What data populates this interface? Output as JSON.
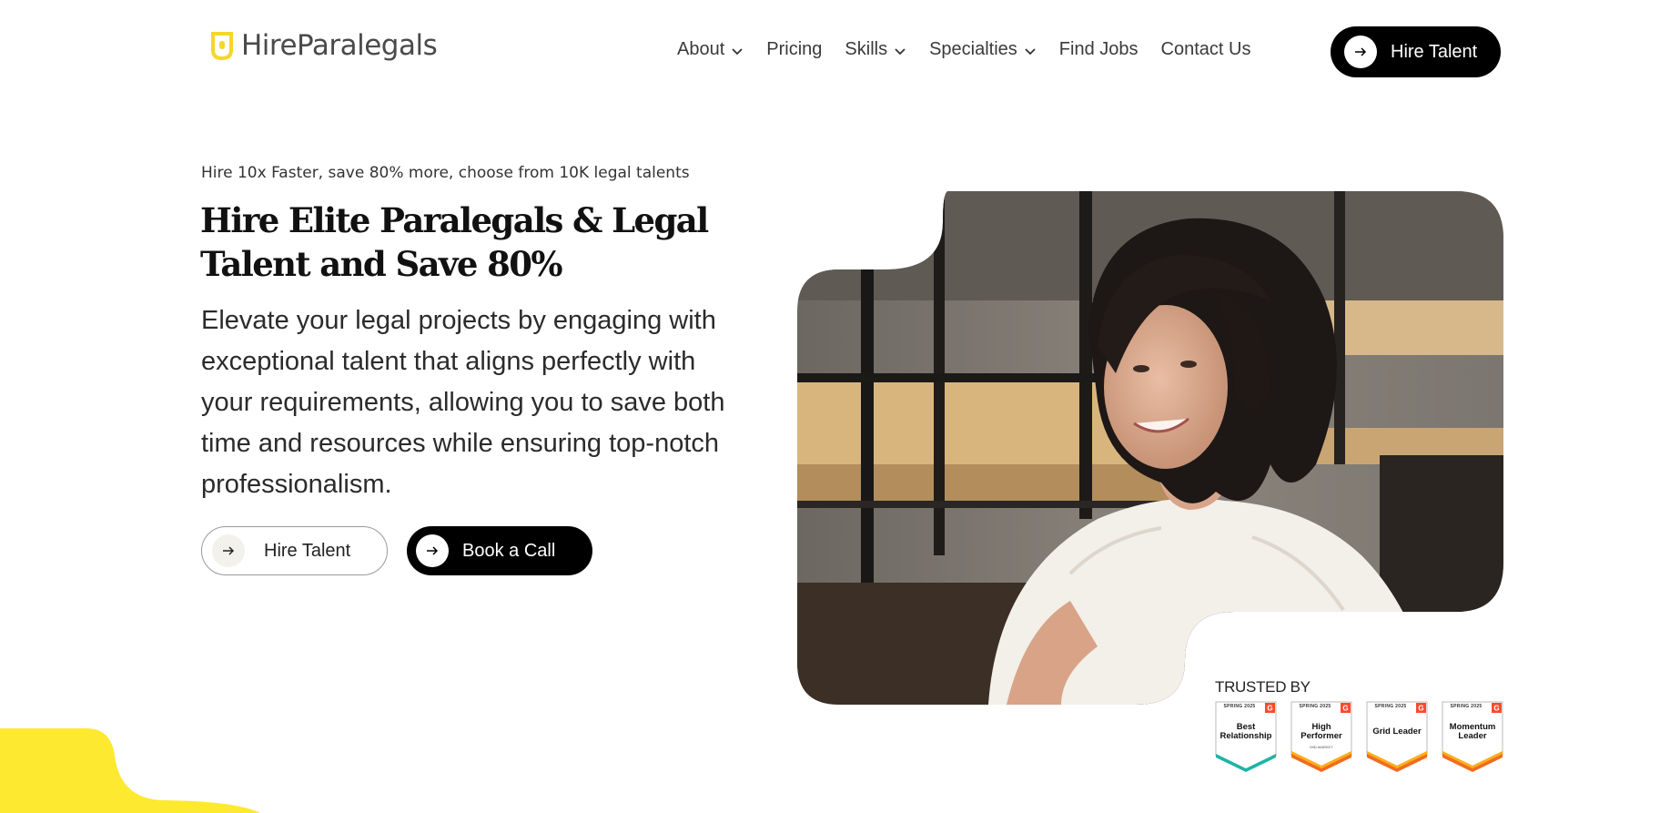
{
  "brand": {
    "name": "HireParalegals",
    "accent": "#f5d62b"
  },
  "nav": {
    "items": [
      {
        "label": "About",
        "has_dropdown": true
      },
      {
        "label": "Pricing",
        "has_dropdown": false
      },
      {
        "label": "Skills",
        "has_dropdown": true
      },
      {
        "label": "Specialties",
        "has_dropdown": true
      },
      {
        "label": "Find Jobs",
        "has_dropdown": false
      },
      {
        "label": "Contact Us",
        "has_dropdown": false
      }
    ],
    "cta_label": "Hire Talent"
  },
  "hero": {
    "eyebrow": "Hire 10x Faster, save 80% more, choose from 10K legal talents",
    "headline": "Hire Elite Paralegals & Legal Talent and Save 80%",
    "lead": "Elevate your legal projects by engaging with exceptional talent that aligns perfectly with your requirements, allowing you to save both time and resources while ensuring top-notch professionalism.",
    "primary_button": "Hire Talent",
    "secondary_button": "Book a Call",
    "image_alt": "smiling-woman-at-desk-photo"
  },
  "trusted": {
    "label": "TRUSTED BY",
    "badges": [
      {
        "season": "SPRING 2025",
        "title": "Best Relationship",
        "subtitle": "",
        "color": "#1fb3a5"
      },
      {
        "season": "SPRING 2025",
        "title": "High Performer",
        "subtitle": "MID-MARKET",
        "color": "#f26b21"
      },
      {
        "season": "SPRING 2025",
        "title": "Grid Leader",
        "subtitle": "",
        "color": "#f26b21"
      },
      {
        "season": "SPRING 2025",
        "title": "Momentum Leader",
        "subtitle": "",
        "color": "#f26b21"
      }
    ]
  },
  "colors": {
    "dark_button": "#000000",
    "text": "#1f1f1f",
    "yellow_blob": "#fde92f",
    "g2_red": "#ff492c"
  }
}
